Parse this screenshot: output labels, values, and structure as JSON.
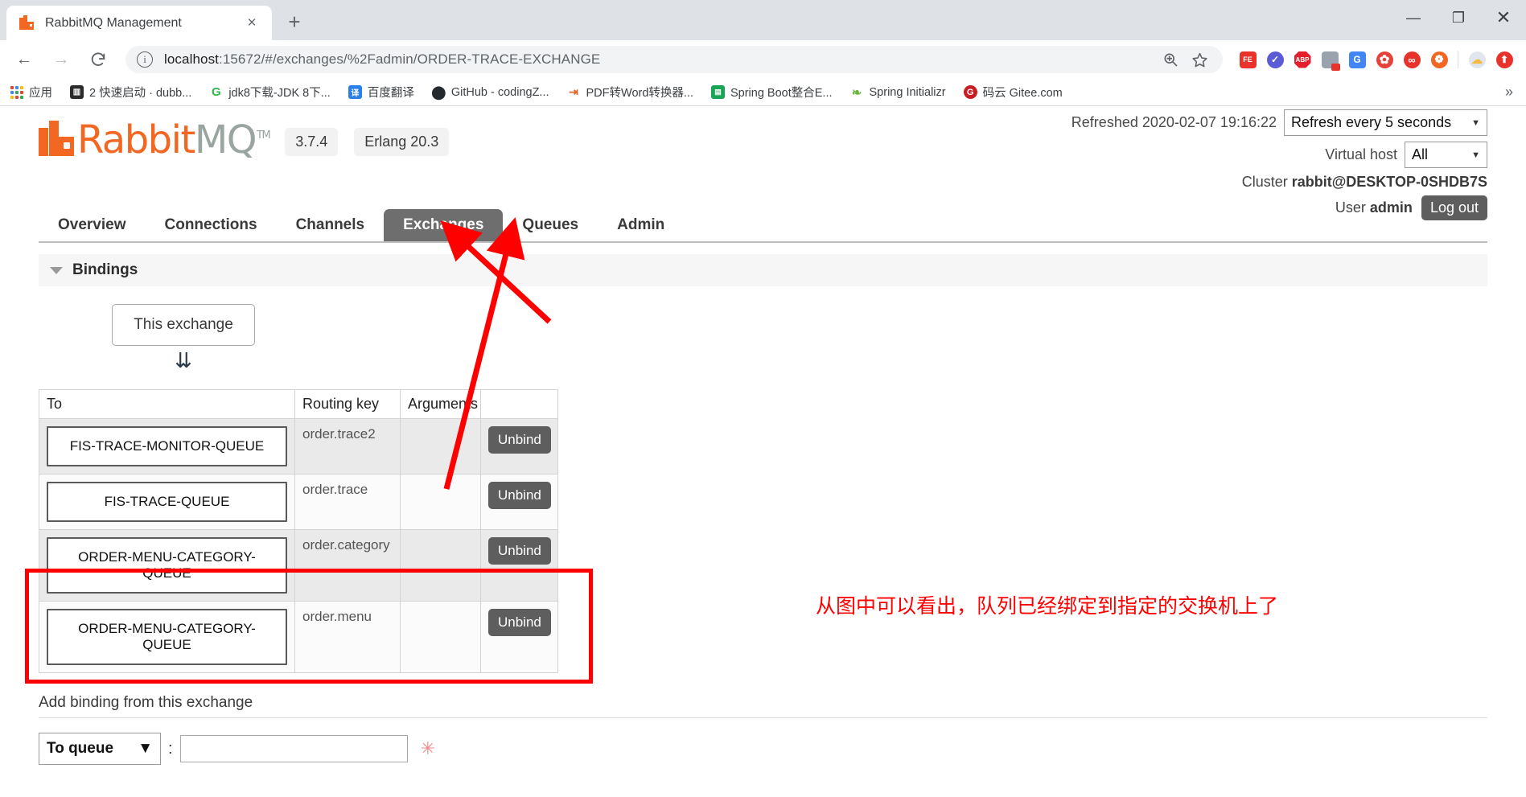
{
  "browser": {
    "tab": {
      "title": "RabbitMQ Management",
      "favicon_icon": "rabbitmq-icon",
      "close_icon": "×"
    },
    "newtab_label": "+",
    "window_controls": {
      "minimize": "—",
      "maximize": "❐",
      "close": "✕"
    },
    "nav": {
      "back": "←",
      "forward": "→",
      "reload": "C"
    },
    "omnibox": {
      "info_icon": "i",
      "url_host": "localhost",
      "url_path": ":15672/#/exchanges/%2Fadmin/ORDER-TRACE-EXCHANGE",
      "zoom_icon": "search-plus-icon",
      "bookmark_icon": "star-icon"
    },
    "extensions": [
      {
        "name": "fe-extension",
        "label": "FE",
        "color": "#e8322c"
      },
      {
        "name": "check-circle-extension",
        "label": "✓",
        "color": "#5b5bd6"
      },
      {
        "name": "adblock-plus-extension",
        "label": "ABP",
        "color": "#e4202e"
      },
      {
        "name": "screenshot-extension",
        "label": "",
        "color": "#9aa3ad"
      },
      {
        "name": "google-translate-extension",
        "label": "G",
        "color": "#4285f4"
      },
      {
        "name": "colors-extension",
        "label": "✿",
        "color": "#e8413a"
      },
      {
        "name": "infinity-extension",
        "label": "∞",
        "color": "#e8322c"
      },
      {
        "name": "orange-dot-extension",
        "label": "❁",
        "color": "#f26722"
      },
      {
        "name": "weather-extension",
        "label": "☁",
        "color": "#dfe6ee"
      },
      {
        "name": "upload-extension",
        "label": "⬆",
        "color": "#e8322c"
      }
    ],
    "bookmarks": [
      {
        "name": "apps",
        "label": "应用",
        "icon": "apps-grid-icon",
        "color": ""
      },
      {
        "name": "dubbo-quickstart",
        "label": "2 快速启动 · dubb...",
        "icon": "book-icon",
        "color": "#3c4043"
      },
      {
        "name": "jdk8-download",
        "label": "jdk8下载-JDK 8下...",
        "icon": "g-icon",
        "color": "#2cb84a"
      },
      {
        "name": "baidu-translate",
        "label": "百度翻译",
        "icon": "translate-icon",
        "color": "#2a7fe8"
      },
      {
        "name": "github-codingz",
        "label": "GitHub - codingZ...",
        "icon": "github-icon",
        "color": "#24292e"
      },
      {
        "name": "pdf-to-word",
        "label": "PDF转Word转换器...",
        "icon": "pdf-icon",
        "color": "#e8622c"
      },
      {
        "name": "spring-boot-integration",
        "label": "Spring Boot整合E...",
        "icon": "spring-icon",
        "color": "#18a558"
      },
      {
        "name": "spring-initializr",
        "label": "Spring Initializr",
        "icon": "leaf-icon",
        "color": "#6db33f"
      },
      {
        "name": "gitee",
        "label": "码云 Gitee.com",
        "icon": "gitee-icon",
        "color": "#c71d23"
      }
    ],
    "bookmarks_overflow": "»"
  },
  "app": {
    "logo": {
      "orange_part": "Rabbit",
      "gray_part": "MQ",
      "tm": "TM"
    },
    "version_badge": "3.7.4",
    "erlang_badge": "Erlang 20.3",
    "refreshed_label": "Refreshed 2020-02-07 19:16:22",
    "refresh_select": {
      "value": "Refresh every 5 seconds",
      "caret": "▼"
    },
    "vhost_label": "Virtual host",
    "vhost_select": {
      "value": "All",
      "caret": "▼"
    },
    "cluster_label": "Cluster",
    "cluster_value": "rabbit@DESKTOP-0SHDB7S",
    "user_label": "User",
    "user_value": "admin",
    "logout_label": "Log out",
    "nav_tabs": [
      {
        "name": "overview",
        "label": "Overview",
        "active": false
      },
      {
        "name": "connections",
        "label": "Connections",
        "active": false
      },
      {
        "name": "channels",
        "label": "Channels",
        "active": false
      },
      {
        "name": "exchanges",
        "label": "Exchanges",
        "active": true
      },
      {
        "name": "queues",
        "label": "Queues",
        "active": false
      },
      {
        "name": "admin",
        "label": "Admin",
        "active": false
      }
    ]
  },
  "bindings": {
    "section_title": "Bindings",
    "exchange_box_label": "This exchange",
    "down_arrow_glyph": "⇊",
    "columns": [
      "To",
      "Routing key",
      "Arguments",
      ""
    ],
    "rows": [
      {
        "to": "FIS-TRACE-MONITOR-QUEUE",
        "routing_key": "order.trace2",
        "arguments": "",
        "action": "Unbind"
      },
      {
        "to": "FIS-TRACE-QUEUE",
        "routing_key": "order.trace",
        "arguments": "",
        "action": "Unbind"
      },
      {
        "to": "ORDER-MENU-CATEGORY-QUEUE",
        "routing_key": "order.category",
        "arguments": "",
        "action": "Unbind"
      },
      {
        "to": "ORDER-MENU-CATEGORY-QUEUE",
        "routing_key": "order.menu",
        "arguments": "",
        "action": "Unbind"
      }
    ]
  },
  "annotation": {
    "text": "从图中可以看出，队列已经绑定到指定的交换机上了",
    "color": "#ff0000"
  },
  "add_binding": {
    "title": "Add binding from this exchange",
    "dest_select": {
      "value": "To queue",
      "caret": "▼"
    },
    "colon": ":",
    "dest_input_value": "",
    "required_marker": "✳"
  }
}
